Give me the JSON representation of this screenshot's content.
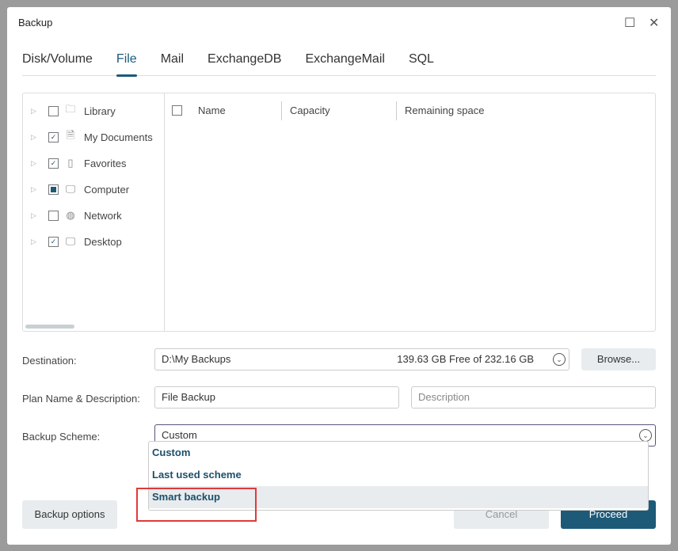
{
  "dialog": {
    "title": "Backup"
  },
  "tabs": [
    "Disk/Volume",
    "File",
    "Mail",
    "ExchangeDB",
    "ExchangeMail",
    "SQL"
  ],
  "active_tab": "File",
  "tree": [
    {
      "label": "Library",
      "state": "unchecked",
      "icon": "folder-icon"
    },
    {
      "label": "My Documents",
      "state": "checked",
      "icon": "document-icon"
    },
    {
      "label": "Favorites",
      "state": "checked",
      "icon": "favorites-icon"
    },
    {
      "label": "Computer",
      "state": "partial",
      "icon": "computer-icon"
    },
    {
      "label": "Network",
      "state": "unchecked",
      "icon": "network-icon"
    },
    {
      "label": "Desktop",
      "state": "checked",
      "icon": "desktop-icon"
    }
  ],
  "columns": [
    "Name",
    "Capacity",
    "Remaining space"
  ],
  "destination": {
    "label": "Destination:",
    "path": "D:\\My Backups",
    "free": "139.63 GB Free of 232.16 GB",
    "browse": "Browse..."
  },
  "plan": {
    "label": "Plan Name & Description:",
    "name": "File Backup",
    "description_placeholder": "Description"
  },
  "scheme": {
    "label": "Backup Scheme:",
    "value": "Custom",
    "options": [
      "Custom",
      "Last used scheme",
      "Smart backup"
    ],
    "highlighted": "Smart backup"
  },
  "footer": {
    "options": "Backup options",
    "cancel": "Cancel",
    "proceed": "Proceed"
  }
}
